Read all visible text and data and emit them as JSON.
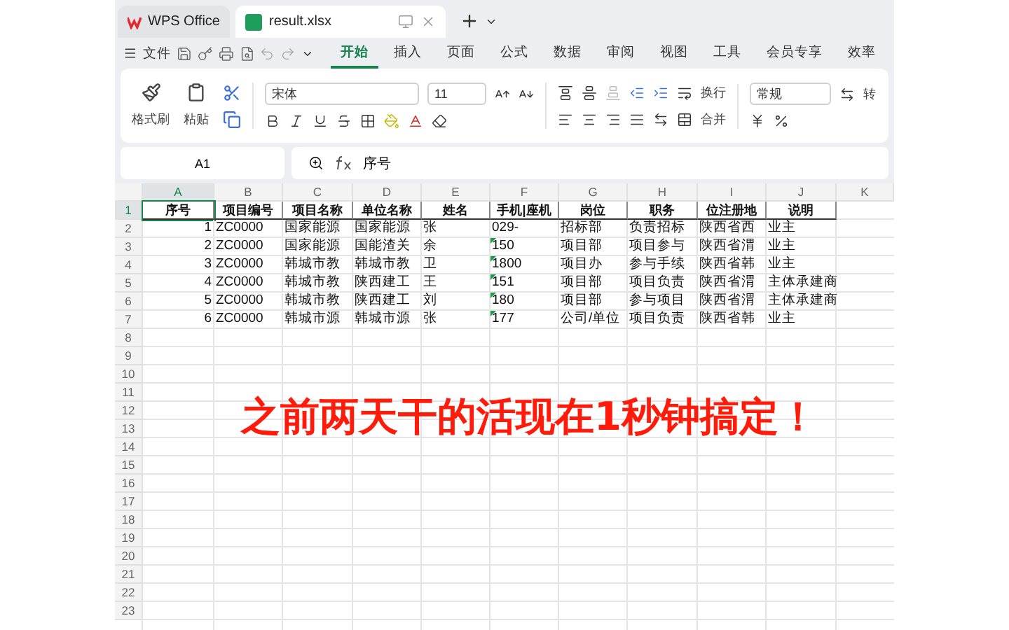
{
  "tabs": [
    {
      "label": "WPS Office",
      "kind": "home",
      "selected": false
    },
    {
      "label": "result.xlsx",
      "kind": "sheet",
      "selected": true
    }
  ],
  "menu": {
    "file": "文件",
    "tabs": [
      {
        "label": "开始",
        "selected": true
      },
      {
        "label": "插入",
        "selected": false
      },
      {
        "label": "页面",
        "selected": false
      },
      {
        "label": "公式",
        "selected": false
      },
      {
        "label": "数据",
        "selected": false
      },
      {
        "label": "审阅",
        "selected": false
      },
      {
        "label": "视图",
        "selected": false
      },
      {
        "label": "工具",
        "selected": false
      },
      {
        "label": "会员专享",
        "selected": false
      },
      {
        "label": "效率",
        "selected": false
      }
    ]
  },
  "ribbon": {
    "format_painter": "格式刷",
    "paste": "粘贴",
    "font": "宋体",
    "size": "11",
    "wrap": "换行",
    "merge": "合并",
    "number_format": "常规",
    "convert": "转"
  },
  "formula_bar": {
    "cell": "A1",
    "value": "序号"
  },
  "sheet": {
    "columns": [
      {
        "label": "A",
        "selected": true
      },
      {
        "label": "B",
        "selected": false
      },
      {
        "label": "C",
        "selected": false
      },
      {
        "label": "D",
        "selected": false
      },
      {
        "label": "E",
        "selected": false
      },
      {
        "label": "F",
        "selected": false
      },
      {
        "label": "G",
        "selected": false
      },
      {
        "label": "H",
        "selected": false
      },
      {
        "label": "I",
        "selected": false
      },
      {
        "label": "J",
        "selected": false
      },
      {
        "label": "K",
        "selected": false
      }
    ],
    "rows": [
      {
        "number": "1",
        "kind": "header",
        "selected": true,
        "flag": false,
        "cells": [
          "序号",
          "项目编号",
          "项目名称",
          "单位名称",
          "姓名",
          "手机|座机",
          "岗位",
          "职务",
          "位注册地",
          "说明"
        ]
      },
      {
        "number": "2",
        "kind": "data",
        "selected": false,
        "flag": false,
        "cells": [
          "1",
          "ZC0000",
          "国家能源",
          "国家能源",
          "张",
          "029-",
          "招标部",
          "负责招标",
          "陕西省西",
          "业主"
        ]
      },
      {
        "number": "3",
        "kind": "data",
        "selected": false,
        "flag": true,
        "cells": [
          "2",
          "ZC0000",
          "国家能源",
          "国能渣关",
          "余",
          "150",
          "项目部",
          "项目参与",
          "陕西省渭",
          "业主"
        ]
      },
      {
        "number": "4",
        "kind": "data",
        "selected": false,
        "flag": true,
        "cells": [
          "3",
          "ZC0000",
          "韩城市教",
          "韩城市教",
          "卫",
          "1800",
          "项目办",
          "参与手续",
          "陕西省韩",
          "业主"
        ]
      },
      {
        "number": "5",
        "kind": "data",
        "selected": false,
        "flag": true,
        "cells": [
          "4",
          "ZC0000",
          "韩城市教",
          "陕西建工",
          "王",
          "151",
          "项目部",
          "项目负责",
          "陕西省渭",
          "主体承建商"
        ]
      },
      {
        "number": "6",
        "kind": "data",
        "selected": false,
        "flag": true,
        "cells": [
          "5",
          "ZC0000",
          "韩城市教",
          "陕西建工",
          "刘",
          "180",
          "项目部",
          "参与项目",
          "陕西省渭",
          "主体承建商"
        ]
      },
      {
        "number": "7",
        "kind": "data",
        "selected": false,
        "flag": true,
        "cells": [
          "6",
          "ZC0000",
          "韩城市源",
          "韩城市源",
          "张",
          "177",
          "公司/单位",
          "项目负责",
          "陕西省韩",
          "业主"
        ]
      },
      {
        "number": "8",
        "kind": "empty",
        "selected": false
      },
      {
        "number": "9",
        "kind": "empty",
        "selected": false
      },
      {
        "number": "10",
        "kind": "empty",
        "selected": false
      },
      {
        "number": "11",
        "kind": "empty",
        "selected": false
      },
      {
        "number": "12",
        "kind": "empty",
        "selected": false
      },
      {
        "number": "13",
        "kind": "empty",
        "selected": false
      },
      {
        "number": "14",
        "kind": "empty",
        "selected": false
      },
      {
        "number": "15",
        "kind": "empty",
        "selected": false
      },
      {
        "number": "16",
        "kind": "empty",
        "selected": false
      },
      {
        "number": "17",
        "kind": "empty",
        "selected": false
      },
      {
        "number": "18",
        "kind": "empty",
        "selected": false
      },
      {
        "number": "19",
        "kind": "empty",
        "selected": false
      },
      {
        "number": "20",
        "kind": "empty",
        "selected": false
      },
      {
        "number": "21",
        "kind": "empty",
        "selected": false
      },
      {
        "number": "22",
        "kind": "empty",
        "selected": false
      },
      {
        "number": "23",
        "kind": "empty",
        "selected": false
      }
    ]
  },
  "caption": "之前两天干的活现在1秒钟搞定！"
}
